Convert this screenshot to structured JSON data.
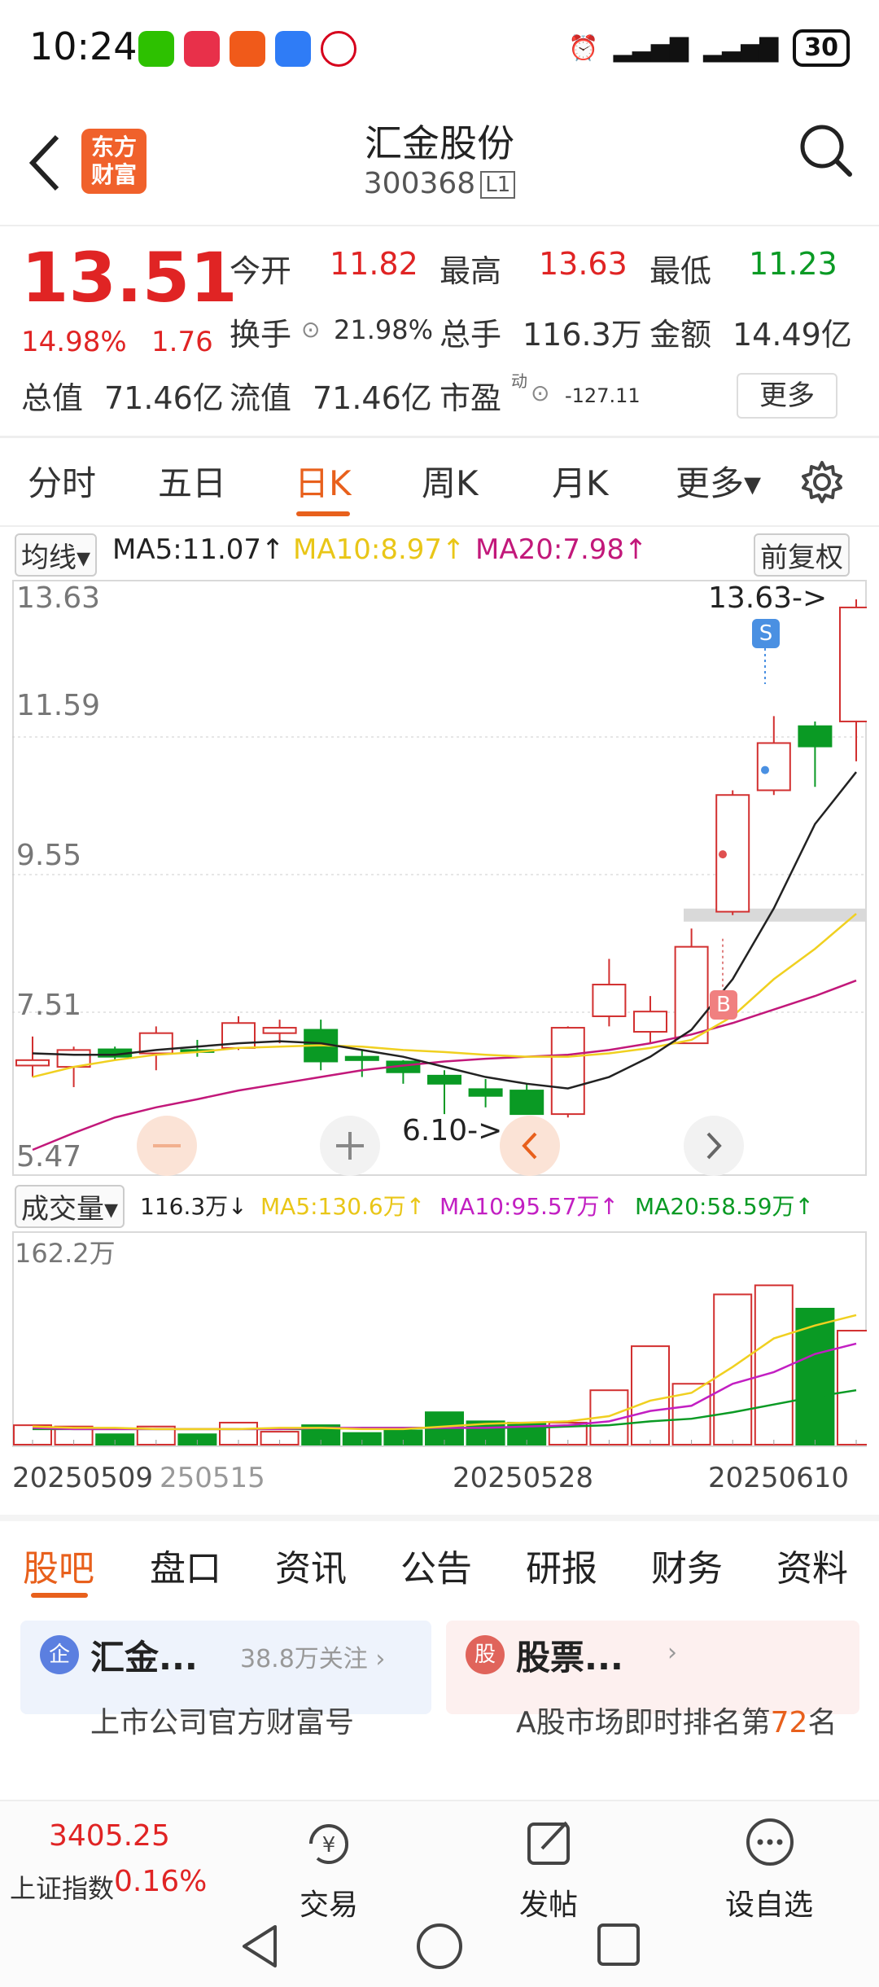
{
  "status_bar": {
    "time": "10:24",
    "battery": "30"
  },
  "header": {
    "stock_name": "汇金股份",
    "stock_code": "300368",
    "level": "L1",
    "logo_text_1": "东方",
    "logo_text_2": "财富"
  },
  "quote": {
    "price": "13.51",
    "change_pct": "14.98%",
    "change_amt": "1.76",
    "open_label": "今开",
    "open": "11.82",
    "high_label": "最高",
    "high": "13.63",
    "low_label": "最低",
    "low": "11.23",
    "turnover_label": "换手",
    "turnover": "21.98%",
    "volume_label": "总手",
    "volume": "116.3万",
    "amount_label": "金额",
    "amount": "14.49亿",
    "mcap_label": "总值",
    "mcap": "71.46亿",
    "float_label": "流值",
    "float": "71.46亿",
    "pe_label": "市盈",
    "pe_sup": "动",
    "pe": "-127.11",
    "more": "更多"
  },
  "chart_tabs": [
    "分时",
    "五日",
    "日K",
    "周K",
    "月K",
    "更多▾"
  ],
  "ma_bar": {
    "selector": "均线▾",
    "ma5": "MA5:11.07↑",
    "ma10": "MA10:8.97↑",
    "ma20": "MA20:7.98↑",
    "adjust": "前复权"
  },
  "price_axis": [
    "13.63",
    "11.59",
    "9.55",
    "7.51",
    "5.47"
  ],
  "annotations": {
    "high_marker": "13.63->",
    "low_marker": "6.10->",
    "sell_badge": "S",
    "buy_badge": "B"
  },
  "vol_bar": {
    "selector": "成交量▾",
    "vol": "116.3万↓",
    "ma5": "MA5:130.6万↑",
    "ma10": "MA10:95.57万↑",
    "ma20": "MA20:58.59万↑",
    "max": "162.2万"
  },
  "dates": [
    "20250509",
    "250515",
    "20250528",
    "20250610"
  ],
  "chart_data": {
    "type": "candlestick",
    "dates": [
      "20250506",
      "20250507",
      "20250508",
      "20250509",
      "20250512",
      "20250513",
      "20250514",
      "20250515",
      "20250516",
      "20250519",
      "20250520",
      "20250521",
      "20250522",
      "20250523",
      "20250526",
      "20250527",
      "20250528",
      "20250529",
      "20250530",
      "20250603",
      "20250604",
      "20250605",
      "20250606",
      "20250609",
      "20250610",
      "20250611",
      "20250612",
      "20250613",
      "20250616",
      "20250617",
      "20250618",
      "20250619",
      "20250620",
      "20250623",
      "20250624"
    ],
    "candles": [
      {
        "o": 6.72,
        "c": 6.8,
        "h": 7.15,
        "l": 6.55
      },
      {
        "o": 6.7,
        "c": 6.95,
        "h": 7.0,
        "l": 6.4
      },
      {
        "o": 6.96,
        "c": 6.85,
        "h": 7.0,
        "l": 6.8
      },
      {
        "o": 6.9,
        "c": 7.2,
        "h": 7.3,
        "l": 6.65
      },
      {
        "o": 6.95,
        "c": 6.92,
        "h": 7.1,
        "l": 6.85
      },
      {
        "o": 6.98,
        "c": 7.35,
        "h": 7.45,
        "l": 6.95
      },
      {
        "o": 7.2,
        "c": 7.28,
        "h": 7.4,
        "l": 7.05
      },
      {
        "o": 7.25,
        "c": 6.78,
        "h": 7.4,
        "l": 6.65
      },
      {
        "o": 6.85,
        "c": 6.8,
        "h": 6.95,
        "l": 6.55
      },
      {
        "o": 6.78,
        "c": 6.62,
        "h": 6.8,
        "l": 6.45
      },
      {
        "o": 6.57,
        "c": 6.45,
        "h": 6.65,
        "l": 6.0
      },
      {
        "o": 6.37,
        "c": 6.27,
        "h": 6.52,
        "l": 6.1
      },
      {
        "o": 6.35,
        "c": 6.0,
        "h": 6.45,
        "l": 6.0
      },
      {
        "o": 6.0,
        "c": 7.28,
        "h": 7.3,
        "l": 5.95
      },
      {
        "o": 7.45,
        "c": 7.92,
        "h": 8.3,
        "l": 7.3
      },
      {
        "o": 7.22,
        "c": 7.52,
        "h": 7.75,
        "l": 7.05
      },
      {
        "o": 7.05,
        "c": 8.48,
        "h": 8.75,
        "l": 7.05
      },
      {
        "o": 9.0,
        "c": 10.73,
        "h": 10.8,
        "l": 8.95
      },
      {
        "o": 10.8,
        "c": 11.5,
        "h": 11.9,
        "l": 10.73
      },
      {
        "o": 11.75,
        "c": 11.45,
        "h": 11.82,
        "l": 10.85
      },
      {
        "o": 11.82,
        "c": 13.51,
        "h": 13.63,
        "l": 11.23
      }
    ],
    "ma5": [
      6.9,
      6.88,
      6.88,
      6.95,
      7.0,
      7.05,
      7.08,
      7.05,
      6.95,
      6.85,
      6.7,
      6.55,
      6.45,
      6.38,
      6.55,
      6.85,
      7.25,
      8.0,
      9.05,
      10.3,
      11.07
    ],
    "ma10": [
      6.55,
      6.7,
      6.8,
      6.88,
      6.92,
      6.98,
      7.0,
      7.02,
      7.0,
      6.95,
      6.92,
      6.88,
      6.85,
      6.85,
      6.9,
      6.98,
      7.1,
      7.45,
      8.0,
      8.45,
      8.97
    ],
    "ma20": [
      5.47,
      5.72,
      5.95,
      6.1,
      6.22,
      6.35,
      6.45,
      6.55,
      6.65,
      6.72,
      6.78,
      6.82,
      6.85,
      6.88,
      6.95,
      7.05,
      7.18,
      7.35,
      7.55,
      7.75,
      7.98
    ],
    "volumes_wan": [
      15,
      14,
      8,
      14,
      8,
      17,
      10,
      15,
      9,
      11,
      25,
      18,
      17,
      17,
      42,
      76,
      47,
      116,
      123,
      105,
      88
    ],
    "vol_ma5": [
      14,
      13,
      13,
      12,
      12,
      12,
      13,
      13,
      12,
      12,
      14,
      16,
      17,
      18,
      22,
      34,
      40,
      60,
      82,
      92,
      100
    ],
    "vol_ma10": [
      13,
      12,
      12,
      12,
      12,
      12,
      12,
      13,
      13,
      13,
      13,
      13,
      14,
      15,
      18,
      26,
      30,
      47,
      56,
      70,
      78
    ],
    "vol_ma20": [
      12,
      12,
      12,
      12,
      12,
      12,
      12,
      12,
      13,
      13,
      13,
      13,
      13,
      14,
      15,
      18,
      20,
      25,
      31,
      37,
      42
    ],
    "ylim": [
      5.47,
      13.63
    ],
    "vol_ylim": [
      0,
      162.2
    ]
  },
  "bottom_tabs": [
    "股吧",
    "盘口",
    "资讯",
    "公告",
    "研报",
    "财务",
    "资料"
  ],
  "cards": [
    {
      "icon": "企",
      "title": "汇金...",
      "meta": "38.8万关注 ›",
      "sub": "上市公司官方财富号"
    },
    {
      "icon": "股",
      "title": "股票...",
      "meta": "›",
      "sub_a": "A股市场即时排名第",
      "sub_rank": "72",
      "sub_b": "名"
    }
  ],
  "bottom_bar": {
    "index_value": "3405.25",
    "index_name": "上证指数",
    "index_change": "0.16%",
    "trade": "交易",
    "post": "发帖",
    "watch": "设自选"
  }
}
